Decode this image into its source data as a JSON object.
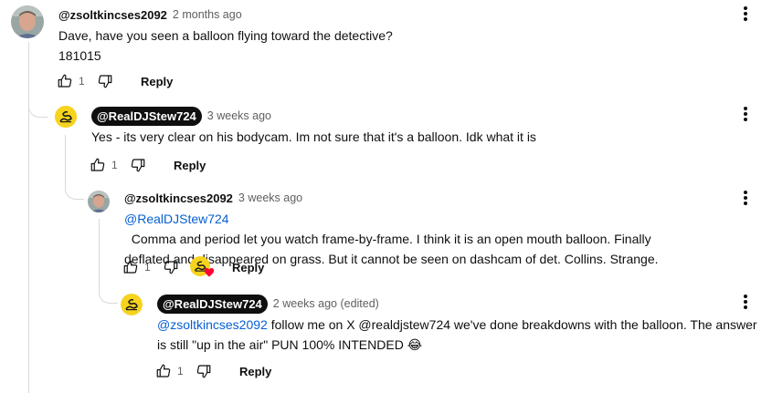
{
  "comments": [
    {
      "author": "@zsoltkincses2092",
      "time": "2 months ago",
      "text": "Dave, have you seen a balloon flying toward the detective?",
      "text2": "181015",
      "likes": "1",
      "reply_label": "Reply"
    },
    {
      "author": "@RealDJStew724",
      "time": "3 weeks ago",
      "text": "Yes - its very clear on his bodycam. Im not sure that it's a balloon. Idk what it is",
      "likes": "1",
      "reply_label": "Reply"
    },
    {
      "author": "@zsoltkincses2092",
      "time": "3 weeks ago",
      "mention": "@RealDJStew724",
      "text_line1": "  Comma and period let you watch frame-by-frame. I think it is an open mouth balloon. Finally",
      "text_line2": "deflated and disappeared on grass. But it cannot be seen on dashcam of det. Collins. Strange.",
      "likes": "1",
      "reply_label": "Reply"
    },
    {
      "author": "@RealDJStew724",
      "time": "2 weeks ago (edited)",
      "mention": "@zsoltkincses2092",
      "text_line1": " follow me on X @realdjstew724 we've done breakdowns with the balloon. The answer",
      "text_line2": "is still \"up in the air\" PUN 100% INTENDED 😂",
      "likes": "1",
      "reply_label": "Reply"
    }
  ],
  "colors": {
    "mention": "#065fd4",
    "meta": "#606060",
    "heart": "#ff0033",
    "flag": "#f6d31d"
  }
}
